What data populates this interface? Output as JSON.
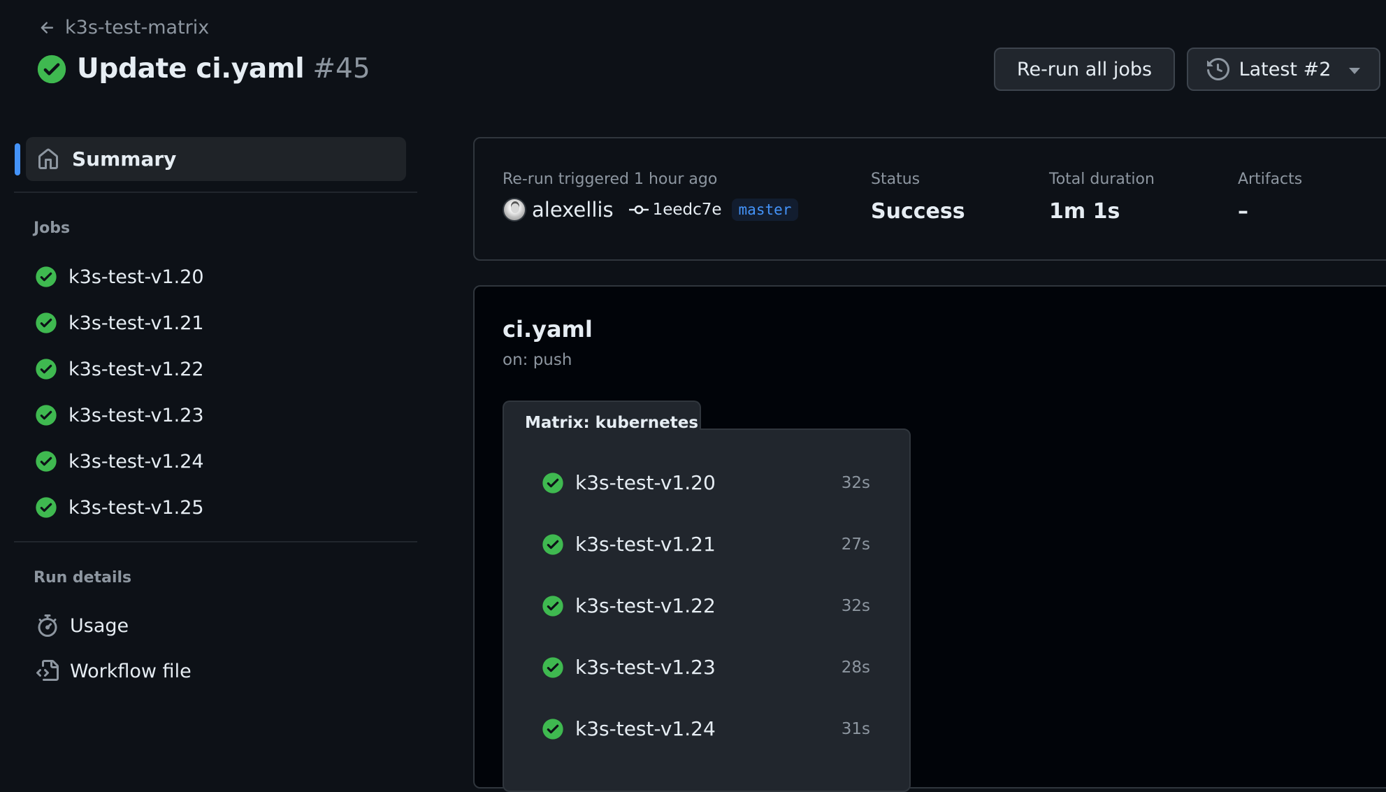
{
  "header": {
    "back_label": "k3s-test-matrix",
    "title": "Update ci.yaml",
    "run_number": "#45",
    "status_icon": "check-circle-fill-icon",
    "rerun_button": "Re-run all jobs",
    "attempt_button": "Latest #2"
  },
  "colors": {
    "success": "#3fb950",
    "accent": "#4493f8",
    "background": "#0d1117"
  },
  "sidebar": {
    "summary_label": "Summary",
    "jobs_heading": "Jobs",
    "jobs": [
      {
        "label": "k3s-test-v1.20",
        "status": "success"
      },
      {
        "label": "k3s-test-v1.21",
        "status": "success"
      },
      {
        "label": "k3s-test-v1.22",
        "status": "success"
      },
      {
        "label": "k3s-test-v1.23",
        "status": "success"
      },
      {
        "label": "k3s-test-v1.24",
        "status": "success"
      },
      {
        "label": "k3s-test-v1.25",
        "status": "success"
      }
    ],
    "run_details_heading": "Run details",
    "run_details": [
      {
        "label": "Usage",
        "icon": "stopwatch-icon"
      },
      {
        "label": "Workflow file",
        "icon": "file-code-icon"
      }
    ]
  },
  "summary": {
    "trigger_label": "Re-run triggered 1 hour ago",
    "actor": "alexellis",
    "commit": "1eedc7e",
    "branch": "master",
    "status_label": "Status",
    "status_value": "Success",
    "duration_label": "Total duration",
    "duration_value": "1m 1s",
    "artifacts_label": "Artifacts",
    "artifacts_value": "–"
  },
  "workflow": {
    "name": "ci.yaml",
    "trigger": "on: push",
    "matrix_label": "Matrix: kubernetes",
    "matrix_jobs": [
      {
        "label": "k3s-test-v1.20",
        "duration": "32s",
        "status": "success"
      },
      {
        "label": "k3s-test-v1.21",
        "duration": "27s",
        "status": "success"
      },
      {
        "label": "k3s-test-v1.22",
        "duration": "32s",
        "status": "success"
      },
      {
        "label": "k3s-test-v1.23",
        "duration": "28s",
        "status": "success"
      },
      {
        "label": "k3s-test-v1.24",
        "duration": "31s",
        "status": "success"
      }
    ]
  }
}
